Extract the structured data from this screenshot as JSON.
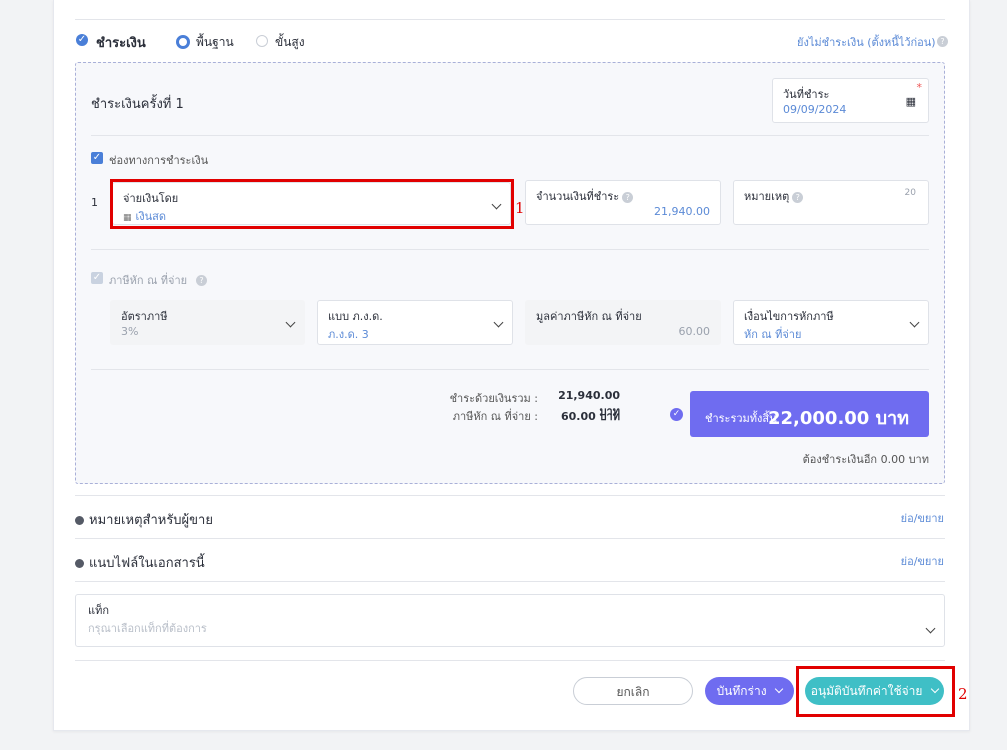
{
  "payment_header": {
    "title": "ชำระเงิน",
    "mode_basic": "พื้นฐาน",
    "mode_advanced": "ขั้นสูง",
    "unpaid_link": "ยังไม่ชำระเงิน (ตั้งหนี้ไว้ก่อน)"
  },
  "installment": {
    "title": "ชำระเงินครั้งที่ 1",
    "date_label": "วันที่ชำระ",
    "date_value": "09/09/2024"
  },
  "channels": {
    "label": "ช่องทางการชำระเงิน",
    "row_index": "1",
    "pay_by_label": "จ่ายเงินโดย",
    "pay_by_value": "เงินสด",
    "amount_label": "จำนวนเงินที่ชำระ",
    "amount_value": "21,940.00",
    "note_label": "หมายเหตุ",
    "note_limit": "20"
  },
  "withholding": {
    "label": "ภาษีหัก ณ ที่จ่าย",
    "rate_label": "อัตราภาษี",
    "rate_value": "3%",
    "form_label": "แบบ ภ.ง.ด.",
    "form_value": "ภ.ง.ด. 3",
    "amount_label": "มูลค่าภาษีหัก ณ ที่จ่าย",
    "amount_value": "60.00",
    "condition_label": "เงื่อนไขการหักภาษี",
    "condition_value": "หัก ณ ที่จ่าย"
  },
  "summary": {
    "paid_total_label": "ชำระด้วยเงินรวม :",
    "paid_total_value": "21,940.00 บาท",
    "wht_label": "ภาษีหัก ณ ที่จ่าย :",
    "wht_value": "60.00 บาท",
    "grand_label": "ชำระรวมทั้งสิ้น",
    "grand_value": "22,000.00 บาท",
    "remaining": "ต้องชำระเงินอีก 0.00 บาท"
  },
  "sections": {
    "seller_note": "หมายเหตุสำหรับผู้ขาย",
    "attach": "แนบไฟล์ในเอกสารนี้",
    "toggle": "ย่อ/ขยาย"
  },
  "tag": {
    "label": "แท็ก",
    "placeholder": "กรุณาเลือกแท็กที่ต้องการ"
  },
  "actions": {
    "cancel": "ยกเลิก",
    "save_draft": "บันทึกร่าง",
    "approve": "อนุมัติบันทึกค่าใช้จ่าย"
  },
  "annotations": {
    "one": "1",
    "two": "2"
  },
  "colors": {
    "primary_blue": "#4a7fd8",
    "purple": "#6f6cf0",
    "teal": "#3fbfc6",
    "annotation_red": "#e10000"
  }
}
